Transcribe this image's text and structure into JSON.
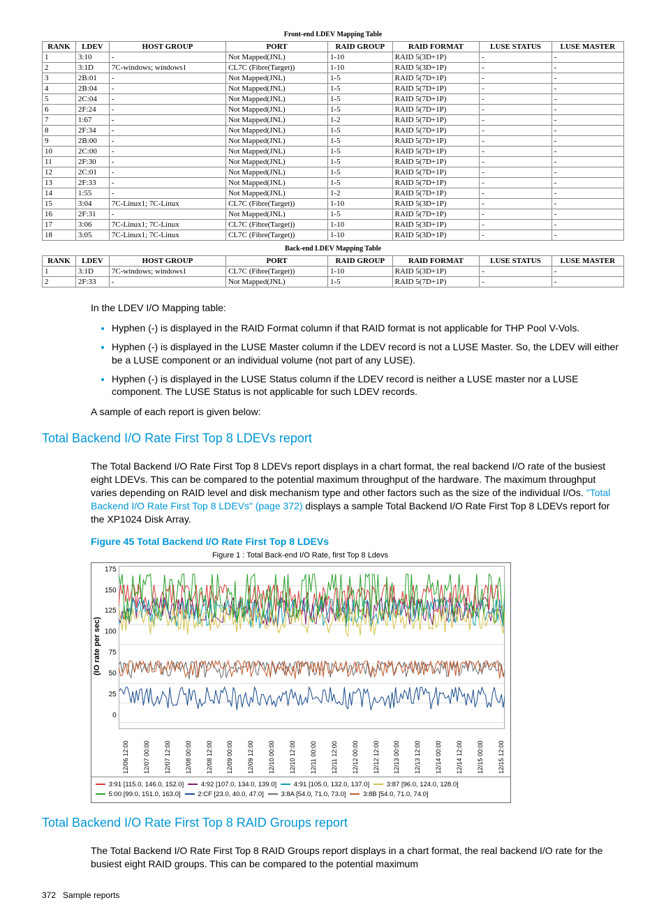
{
  "table1": {
    "title": "Front-end LDEV Mapping Table",
    "headers": [
      "RANK",
      "LDEV",
      "HOST GROUP",
      "PORT",
      "RAID GROUP",
      "RAID FORMAT",
      "LUSE STATUS",
      "LUSE MASTER"
    ],
    "rows": [
      [
        "1",
        "3:10",
        "-",
        "Not Mapped(JNL)",
        "1-10",
        "RAID 5(3D+1P)",
        "-",
        "-"
      ],
      [
        "2",
        "3:1D",
        "7C-windows; windows1",
        "CL7C (Fibre(Target))",
        "1-10",
        "RAID 5(3D+1P)",
        "-",
        "-"
      ],
      [
        "3",
        "2B:01",
        "-",
        "Not Mapped(JNL)",
        "1-5",
        "RAID 5(7D+1P)",
        "-",
        "-"
      ],
      [
        "4",
        "2B:04",
        "-",
        "Not Mapped(JNL)",
        "1-5",
        "RAID 5(7D+1P)",
        "-",
        "-"
      ],
      [
        "5",
        "2C:04",
        "-",
        "Not Mapped(JNL)",
        "1-5",
        "RAID 5(7D+1P)",
        "-",
        "-"
      ],
      [
        "6",
        "2F:24",
        "-",
        "Not Mapped(JNL)",
        "1-5",
        "RAID 5(7D+1P)",
        "-",
        "-"
      ],
      [
        "7",
        "1:67",
        "-",
        "Not Mapped(JNL)",
        "1-2",
        "RAID 5(7D+1P)",
        "-",
        "-"
      ],
      [
        "8",
        "2F:34",
        "-",
        "Not Mapped(JNL)",
        "1-5",
        "RAID 5(7D+1P)",
        "-",
        "-"
      ],
      [
        "9",
        "2B:00",
        "-",
        "Not Mapped(JNL)",
        "1-5",
        "RAID 5(7D+1P)",
        "-",
        "-"
      ],
      [
        "10",
        "2C:00",
        "-",
        "Not Mapped(JNL)",
        "1-5",
        "RAID 5(7D+1P)",
        "-",
        "-"
      ],
      [
        "11",
        "2F:30",
        "-",
        "Not Mapped(JNL)",
        "1-5",
        "RAID 5(7D+1P)",
        "-",
        "-"
      ],
      [
        "12",
        "2C:01",
        "-",
        "Not Mapped(JNL)",
        "1-5",
        "RAID 5(7D+1P)",
        "-",
        "-"
      ],
      [
        "13",
        "2F:33",
        "-",
        "Not Mapped(JNL)",
        "1-5",
        "RAID 5(7D+1P)",
        "-",
        "-"
      ],
      [
        "14",
        "1:55",
        "-",
        "Not Mapped(JNL)",
        "1-2",
        "RAID 5(7D+1P)",
        "-",
        "-"
      ],
      [
        "15",
        "3:04",
        "7C-Linux1; 7C-Linux",
        "CL7C (Fibre(Target))",
        "1-10",
        "RAID 5(3D+1P)",
        "-",
        "-"
      ],
      [
        "16",
        "2F:31",
        "-",
        "Not Mapped(JNL)",
        "1-5",
        "RAID 5(7D+1P)",
        "-",
        "-"
      ],
      [
        "17",
        "3:06",
        "7C-Linux1; 7C-Linux",
        "CL7C (Fibre(Target))",
        "1-10",
        "RAID 5(3D+1P)",
        "-",
        "-"
      ],
      [
        "18",
        "3:05",
        "7C-Linux1; 7C-Linux",
        "CL7C (Fibre(Target))",
        "1-10",
        "RAID 5(3D+1P)",
        "-",
        "-"
      ]
    ]
  },
  "table2": {
    "title": "Back-end LDEV Mapping Table",
    "headers": [
      "RANK",
      "LDEV",
      "HOST GROUP",
      "PORT",
      "RAID GROUP",
      "RAID FORMAT",
      "LUSE STATUS",
      "LUSE MASTER"
    ],
    "rows": [
      [
        "1",
        "3:1D",
        "7C-windows; windows1",
        "CL7C (Fibre(Target))",
        "1-10",
        "RAID 5(3D+1P)",
        "-",
        "-"
      ],
      [
        "2",
        "2F:33",
        "-",
        "Not Mapped(JNL)",
        "1-5",
        "RAID 5(7D+1P)",
        "-",
        "-"
      ]
    ]
  },
  "intro": "In the LDEV I/O Mapping table:",
  "bullets": [
    "Hyphen (-) is displayed in the RAID Format column if that RAID format is not applicable for THP Pool V-Vols.",
    "Hyphen (-) is displayed in the LUSE Master column if the LDEV record is not a LUSE Master. So, the LDEV will either be a LUSE component or an individual volume (not part of any LUSE).",
    "Hyphen (-) is displayed in the LUSE Status column if the LDEV record is neither a LUSE master nor a LUSE component. The LUSE Status is not applicable for such LDEV records."
  ],
  "sample_line": "A sample of each report is given below:",
  "section1": {
    "title": "Total Backend I/O Rate First Top 8 LDEVs report",
    "p1a": "The Total Backend I/O Rate First Top 8 LDEVs report displays in a chart format, the real backend I/O rate of the busiest eight LDEVs. This can be compared to the potential maximum throughput of the hardware. The maximum throughput varies depending on RAID level and disk mechanism type and other factors such as the size of the individual I/Os. ",
    "link": "\"Total Backend I/O Rate First Top 8 LDEVs\" (page 372)",
    "p1b": " displays a sample Total Backend I/O Rate First Top 8 LDEVs report for the XP1024 Disk Array."
  },
  "figcap": "Figure 45 Total Backend I/O Rate First Top 8 LDEVs",
  "chart_data": {
    "type": "line",
    "title": "Figure 1 : Total Back-end I/O Rate, first Top 8 Ldevs",
    "ylabel": "(IO rate per sec)",
    "yticks": [
      175,
      150,
      125,
      100,
      75,
      50,
      25,
      0
    ],
    "xticks": [
      "12/06 12:00",
      "12/07 00:00",
      "12/07 12:00",
      "12/08 00:00",
      "12/08 12:00",
      "12/09 00:00",
      "12/09 12:00",
      "12/10 00:00",
      "12/10 12:00",
      "12/11 00:00",
      "12/11 12:00",
      "12/12 00:00",
      "12/12 12:00",
      "12/13 00:00",
      "12/13 12:00",
      "12/14 00:00",
      "12/14 12:00",
      "12/15 00:00",
      "12/15 12:00"
    ],
    "series": [
      {
        "name": "3:91 [115.0, 146.0, 152.0]",
        "color": "#d93b3b",
        "min": 115,
        "avg": 146,
        "max": 152
      },
      {
        "name": "4:92 [107.0, 134.0, 139.0]",
        "color": "#7a1d6b",
        "min": 107,
        "avg": 134,
        "max": 139
      },
      {
        "name": "4:91 [105.0, 132.0, 137.0]",
        "color": "#13a0b0",
        "min": 105,
        "avg": 132,
        "max": 137
      },
      {
        "name": "3:87 [96.0, 124.0, 128.0]",
        "color": "#d4c24a",
        "min": 96,
        "avg": 124,
        "max": 128
      },
      {
        "name": "5:00 [99.0, 151.0, 163.0]",
        "color": "#2aa02a",
        "min": 99,
        "avg": 151,
        "max": 163
      },
      {
        "name": "2:CF [23.0, 40.0, 47.0]",
        "color": "#1a4b8c",
        "min": 23,
        "avg": 40,
        "max": 47
      },
      {
        "name": "3:8A [54.0, 71.0, 73.0]",
        "color": "#6b6b6b",
        "min": 54,
        "avg": 71,
        "max": 73
      },
      {
        "name": "3:8B [54.0, 71.0, 74.0]",
        "color": "#c05a2e",
        "min": 54,
        "avg": 71,
        "max": 74
      }
    ],
    "ylim": [
      0,
      180
    ]
  },
  "section2": {
    "title": "Total Backend I/O Rate First Top 8 RAID Groups report",
    "p1": "The Total Backend I/O Rate First Top 8 RAID Groups report displays in a chart format, the real backend I/O rate for the busiest eight RAID groups. This can be compared to the potential maximum"
  },
  "footer": {
    "page": "372",
    "label": "Sample reports"
  }
}
